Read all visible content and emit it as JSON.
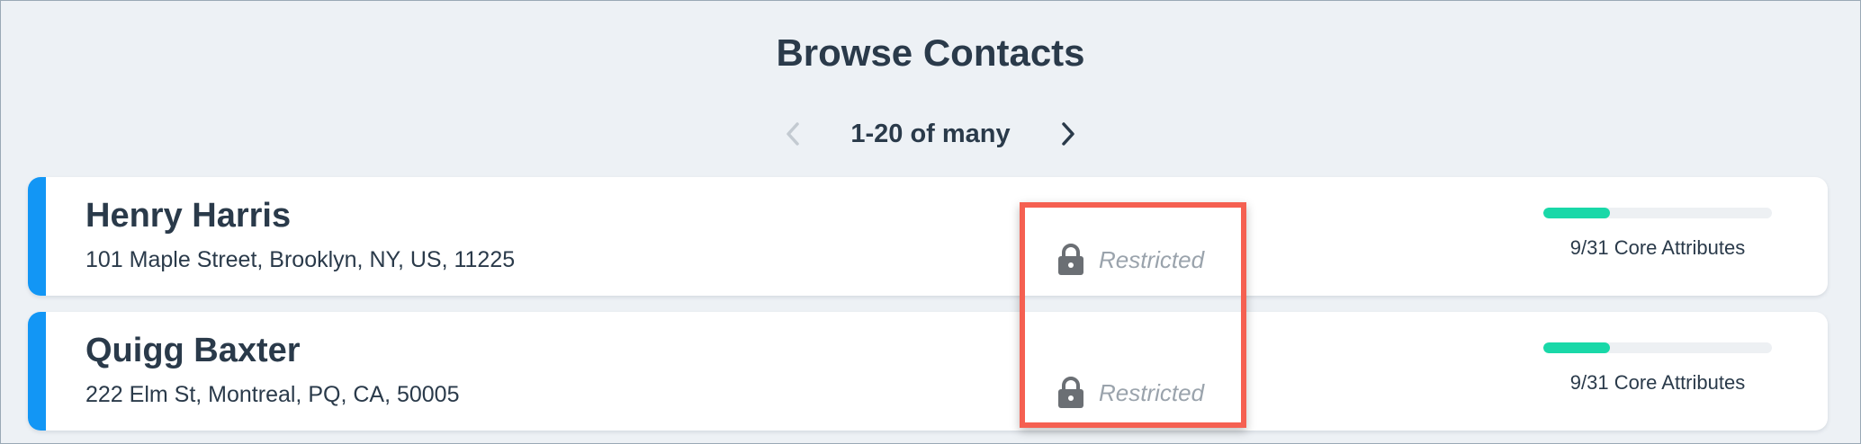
{
  "page": {
    "title": "Browse Contacts"
  },
  "pagination": {
    "label": "1-20 of many",
    "prev_icon": "chevron-left-icon",
    "next_icon": "chevron-right-icon"
  },
  "contacts": [
    {
      "name": "Henry Harris",
      "address": "101 Maple Street, Brooklyn, NY, US, 11225",
      "status": "Restricted",
      "core_attributes_label": "9/31 Core Attributes",
      "core_attributes_fraction": 0.2903
    },
    {
      "name": "Quigg Baxter",
      "address": "222 Elm St, Montreal, PQ, CA, 50005",
      "status": "Restricted",
      "core_attributes_label": "9/31 Core Attributes",
      "core_attributes_fraction": 0.2903
    }
  ],
  "colors": {
    "accent": "#1296f5",
    "progress_fill": "#19d8a8",
    "highlight": "#f56051"
  }
}
